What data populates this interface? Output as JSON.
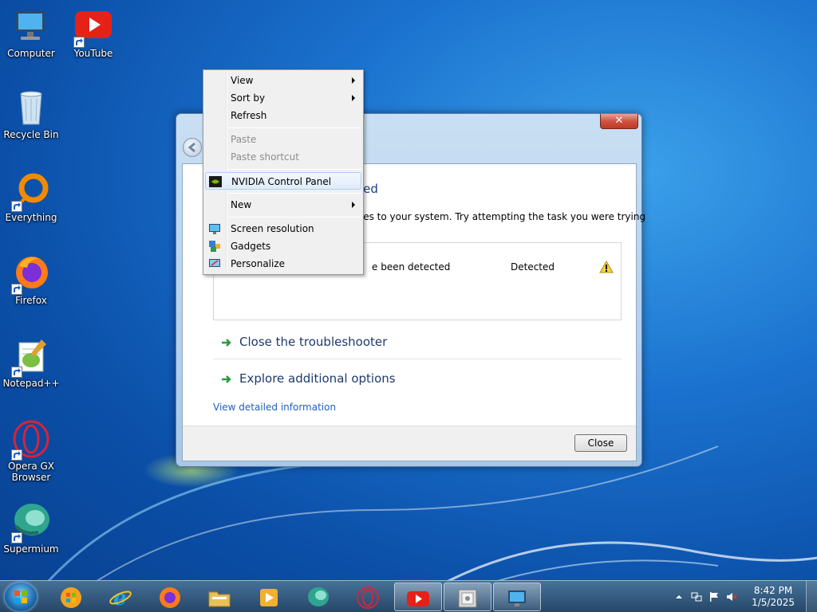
{
  "desktop": {
    "icons": [
      {
        "label": "Computer",
        "icon": "computer-icon"
      },
      {
        "label": "YouTube",
        "icon": "youtube-icon"
      },
      {
        "label": "Recycle Bin",
        "icon": "recycle-bin-icon"
      },
      {
        "label": "Everything",
        "icon": "everything-icon"
      },
      {
        "label": "Firefox",
        "icon": "firefox-icon"
      },
      {
        "label": "Notepad++",
        "icon": "notepadpp-icon"
      },
      {
        "label": "Opera GX Browser",
        "icon": "opera-gx-icon"
      },
      {
        "label": "Supermium",
        "icon": "supermium-icon"
      }
    ]
  },
  "window": {
    "close_glyph": "✕",
    "title_fragment": "eted",
    "description_fragment": "nges to your system. Try attempting the task you were trying",
    "issue": {
      "text": "e been detected",
      "status": "Detected",
      "icon": "warning-icon"
    },
    "options": [
      {
        "label": "Close the troubleshooter",
        "icon": "green-arrow-icon"
      },
      {
        "label": "Explore additional options",
        "icon": "green-arrow-icon"
      }
    ],
    "detail_link": "View detailed information",
    "close_button": "Close"
  },
  "context_menu": {
    "items": [
      {
        "label": "View",
        "submenu": true
      },
      {
        "label": "Sort by",
        "submenu": true
      },
      {
        "label": "Refresh"
      },
      {
        "label": "Paste",
        "disabled": true
      },
      {
        "label": "Paste shortcut",
        "disabled": true
      },
      {
        "label": "NVIDIA Control Panel",
        "icon": "nvidia-icon",
        "highlighted": true
      },
      {
        "label": "New",
        "submenu": true
      },
      {
        "label": "Screen resolution",
        "icon": "screen-resolution-icon"
      },
      {
        "label": "Gadgets",
        "icon": "gadgets-icon"
      },
      {
        "label": "Personalize",
        "icon": "personalize-icon"
      }
    ]
  },
  "taskbar": {
    "pinned": [
      "windows-media-player-icon",
      "internet-explorer-icon",
      "firefox-icon",
      "file-explorer-icon",
      "media-player-icon",
      "supermium-icon",
      "opera-gx-icon",
      "youtube-icon",
      "troubleshooter-icon",
      "computer-icon"
    ],
    "clock": {
      "time": "8:42 PM",
      "date": "1/5/2025"
    }
  },
  "colors": {
    "accent": "#1e6bb0",
    "link": "#1f5fbf",
    "youtube_red": "#e62117",
    "opera_red": "#d6233c"
  }
}
